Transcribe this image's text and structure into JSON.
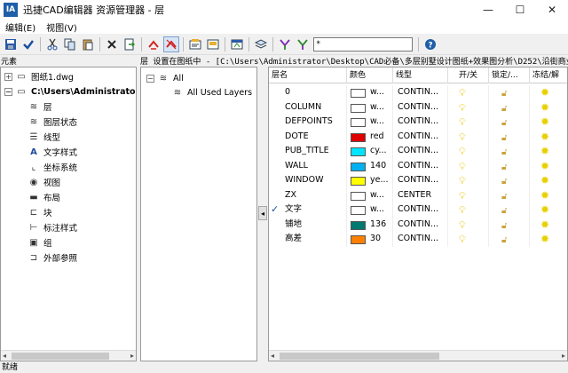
{
  "window": {
    "title": "迅捷CAD编辑器 资源管理器 - 层",
    "app_icon": "IA",
    "minimize": "—",
    "maximize": "☐",
    "close": "✕"
  },
  "menu": {
    "items": [
      "编辑(E)",
      "视图(V)"
    ]
  },
  "toolbar": {
    "icons": [
      "save-icon",
      "check-icon",
      "cut-icon",
      "copy-icon",
      "paste-icon",
      "delete-icon",
      "export-icon",
      "refresh-icon",
      "refresh-red-icon",
      "props-icon",
      "props2-icon",
      "view-icon",
      "layers-icon",
      "filter-icon",
      "filter2-icon",
      "help-icon"
    ],
    "filter_value": "*"
  },
  "left": {
    "header": "元素",
    "items": [
      {
        "label": "图纸1.dwg",
        "expander": "+",
        "icon": "▭",
        "bold": false
      },
      {
        "label": "C:\\Users\\Administrator\\D",
        "expander": "−",
        "icon": "▭",
        "bold": true
      },
      {
        "label": "层",
        "icon": "≋"
      },
      {
        "label": "图层状态",
        "icon": "≋"
      },
      {
        "label": "线型",
        "icon": "☰"
      },
      {
        "label": "文字样式",
        "icon": "A"
      },
      {
        "label": "坐标系统",
        "icon": "⌞"
      },
      {
        "label": "视图",
        "icon": "◉"
      },
      {
        "label": "布局",
        "icon": "▬"
      },
      {
        "label": "块",
        "icon": "⊏"
      },
      {
        "label": "标注样式",
        "icon": "⊢"
      },
      {
        "label": "组",
        "icon": "▣"
      },
      {
        "label": "外部参照",
        "icon": "⊐"
      }
    ]
  },
  "path": "层 设置在图纸中 - [C:\\Users\\Administrator\\Desktop\\CAD必备\\多层别墅设计图纸+效果图分析\\D252\\沿街商业平面.",
  "layer_tree": {
    "root": "All",
    "child": "All Used Layers",
    "collapse": "◂"
  },
  "grid": {
    "headers": [
      "层名",
      "颜色",
      "线型",
      "开/关",
      "锁定/...",
      "冻结/解"
    ],
    "rows": [
      {
        "name": "0",
        "color": "#ffffff",
        "color_name": "w...",
        "linetype": "CONTIN...",
        "current": false
      },
      {
        "name": "COLUMN",
        "color": "#ffffff",
        "color_name": "w...",
        "linetype": "CONTIN...",
        "current": false
      },
      {
        "name": "DEFPOINTS",
        "color": "#ffffff",
        "color_name": "w...",
        "linetype": "CONTIN...",
        "current": false
      },
      {
        "name": "DOTE",
        "color": "#e00000",
        "color_name": "red",
        "linetype": "CONTIN...",
        "current": false
      },
      {
        "name": "PUB_TITLE",
        "color": "#00e5ff",
        "color_name": "cy...",
        "linetype": "CONTIN...",
        "current": false
      },
      {
        "name": "WALL",
        "color": "#00b0f0",
        "color_name": "140",
        "linetype": "CONTIN...",
        "current": false
      },
      {
        "name": "WINDOW",
        "color": "#ffff00",
        "color_name": "ye...",
        "linetype": "CONTIN...",
        "current": false
      },
      {
        "name": "ZX",
        "color": "#ffffff",
        "color_name": "w...",
        "linetype": "CENTER",
        "current": false
      },
      {
        "name": "文字",
        "color": "#ffffff",
        "color_name": "w...",
        "linetype": "CONTIN...",
        "current": true
      },
      {
        "name": "铺地",
        "color": "#007a70",
        "color_name": "136",
        "linetype": "CONTIN...",
        "current": false
      },
      {
        "name": "高差",
        "color": "#ff8000",
        "color_name": "30",
        "linetype": "CONTIN...",
        "current": false
      }
    ]
  },
  "status": "就绪"
}
